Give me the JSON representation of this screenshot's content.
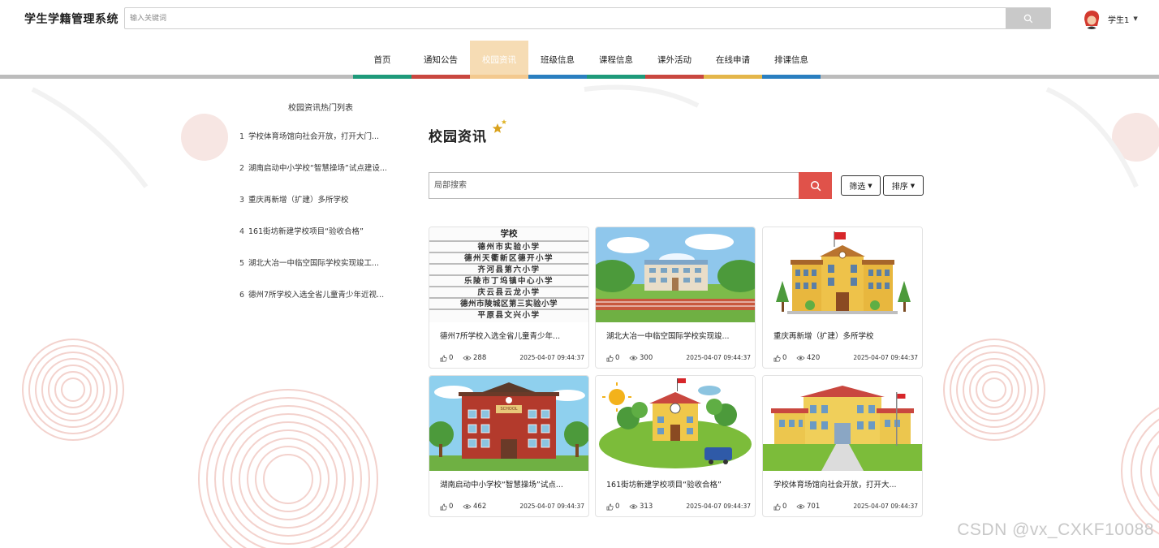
{
  "header": {
    "logo": "学生学籍管理系统",
    "search_placeholder": "输入关键词",
    "user_name": "学生1"
  },
  "nav": {
    "items": [
      {
        "label": "首页",
        "bar_color": "#1e9a7a",
        "active": false
      },
      {
        "label": "通知公告",
        "bar_color": "#c9473f",
        "active": false
      },
      {
        "label": "校园资讯",
        "bar_color": "#f3c98f",
        "active": true
      },
      {
        "label": "班级信息",
        "bar_color": "#2a7fc0",
        "active": false
      },
      {
        "label": "课程信息",
        "bar_color": "#1e9a7a",
        "active": false
      },
      {
        "label": "课外活动",
        "bar_color": "#c9473f",
        "active": false
      },
      {
        "label": "在线申请",
        "bar_color": "#e4b64a",
        "active": false
      },
      {
        "label": "排课信息",
        "bar_color": "#2a7fc0",
        "active": false
      }
    ]
  },
  "sidebar": {
    "title": "校园资讯热门列表",
    "items": [
      {
        "num": "1",
        "text": "学校体育场馆向社会开放，打开大门..."
      },
      {
        "num": "2",
        "text": "湖南启动中小学校“智慧操场”试点建设..."
      },
      {
        "num": "3",
        "text": "重庆再新增（扩建）多所学校"
      },
      {
        "num": "4",
        "text": "161街坊新建学校项目“验收合格”"
      },
      {
        "num": "5",
        "text": "湖北大冶一中临空国际学校实现竣工..."
      },
      {
        "num": "6",
        "text": "德州7所学校入选全省儿童青少年近视..."
      }
    ]
  },
  "main": {
    "title": "校园资讯",
    "search_placeholder": "局部搜索",
    "filter_label": "筛选",
    "sort_label": "排序"
  },
  "school_table": {
    "header": "学校",
    "rows": [
      "德州市实验小学",
      "德州天衢新区德开小学",
      "齐河县第六小学",
      "乐陵市丁坞镇中心小学",
      "庆云县云龙小学",
      "德州市陵城区第三实验小学",
      "平原县文兴小学"
    ]
  },
  "school_sign": "SCHOOL",
  "cards": [
    {
      "title": "德州7所学校入选全省儿童青少年...",
      "likes": "0",
      "views": "288",
      "time": "2025-04-07 09:44:37"
    },
    {
      "title": "湖北大冶一中临空国际学校实现竣...",
      "likes": "0",
      "views": "300",
      "time": "2025-04-07 09:44:37"
    },
    {
      "title": "重庆再新增（扩建）多所学校",
      "likes": "0",
      "views": "420",
      "time": "2025-04-07 09:44:37"
    },
    {
      "title": "湖南启动中小学校“智慧操场”试点...",
      "likes": "0",
      "views": "462",
      "time": "2025-04-07 09:44:37"
    },
    {
      "title": "161街坊新建学校项目“验收合格”",
      "likes": "0",
      "views": "313",
      "time": "2025-04-07 09:44:37"
    },
    {
      "title": "学校体育场馆向社会开放，打开大...",
      "likes": "0",
      "views": "701",
      "time": "2025-04-07 09:44:37"
    }
  ],
  "watermark": "CSDN @vx_CXKF10088",
  "colors": {
    "accent_red": "#e0524a",
    "nav_active_bg": "#f6dcb4",
    "deco_pink": "#f3d6d2"
  }
}
